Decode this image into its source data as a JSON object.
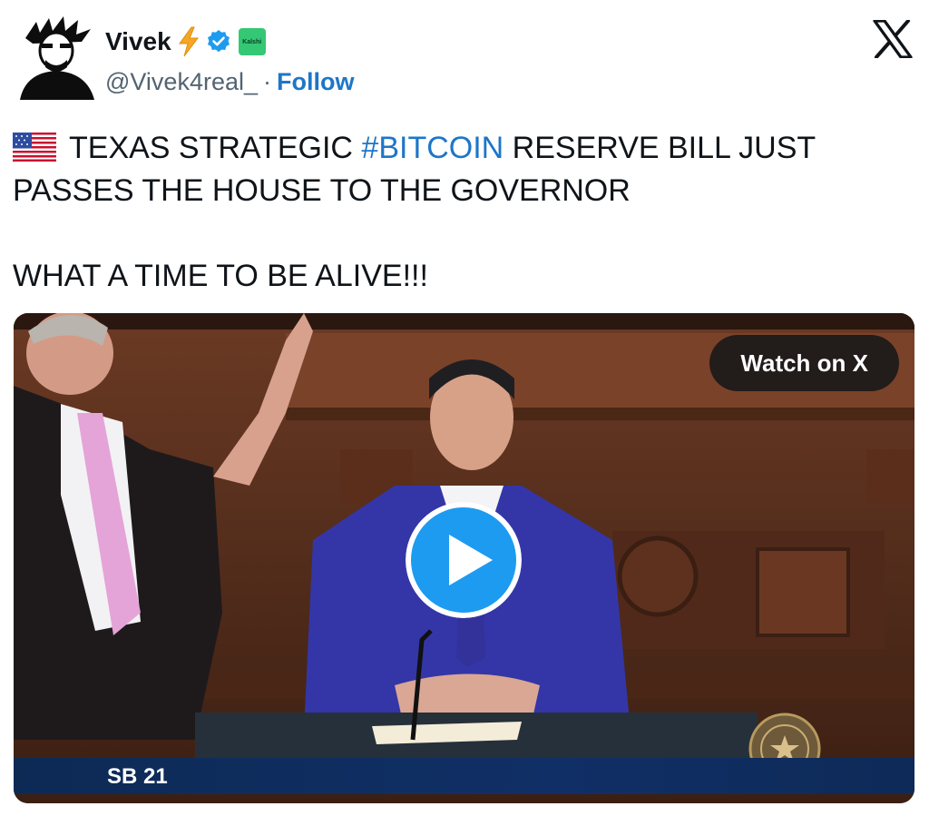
{
  "author": {
    "display_name": "Vivek",
    "handle": "@Vivek4real_",
    "separator": "·",
    "follow_label": "Follow",
    "affiliate_badge": "Kalshi"
  },
  "icons": {
    "avatar": "avatar-silhouette-icon",
    "emoji": "lightning-bolt-icon",
    "verified": "verified-badge-icon",
    "logo": "x-logo-icon",
    "flag": "us-flag-icon",
    "play": "play-icon",
    "seal": "texas-house-seal-icon"
  },
  "tweet": {
    "line1_pre": "TEXAS STRATEGIC ",
    "hashtag": "#BITCOIN",
    "line1_post": " RESERVE BILL JUST PASSES THE HOUSE TO THE GOVERNOR",
    "line2": "WHAT A TIME TO BE ALIVE!!!"
  },
  "media": {
    "watch_label": "Watch on X",
    "bill_label": "SB 21"
  },
  "colors": {
    "accent": "#1d9bf0",
    "link": "#1d76c8",
    "text": "#0f1419",
    "secondary": "#536471"
  }
}
